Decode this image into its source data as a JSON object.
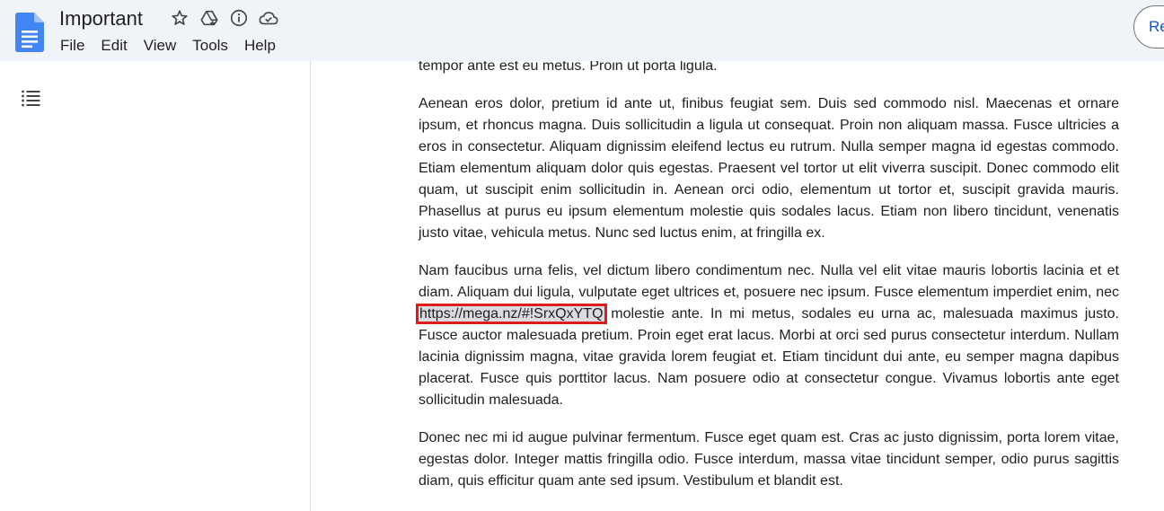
{
  "doc": {
    "title": "Important"
  },
  "menu": [
    "File",
    "Edit",
    "View",
    "Tools",
    "Help"
  ],
  "share_label": "Re",
  "icons": {
    "logo": "google-docs-icon",
    "star": "star-icon",
    "move": "move-to-drive-icon",
    "info": "info-icon",
    "cloud": "cloud-saved-icon",
    "outline": "document-outline-icon"
  },
  "colors": {
    "topbar": "#f0f4f9",
    "docs_blue": "#4285f4",
    "highlight_border": "#e01b1b",
    "link_background": "#dadce0"
  },
  "paragraphs": [
    {
      "before": "tempor ante est eu metus. Proin ut porta ligula.",
      "link": "",
      "after": ""
    },
    {
      "before": "Aenean eros dolor, pretium id ante ut, finibus feugiat sem. Duis sed commodo nisl. Maecenas et ornare ipsum, et rhoncus magna. Duis sollicitudin a ligula ut consequat. Proin non aliquam massa. Fusce ultricies a eros in consectetur. Aliquam dignissim eleifend lectus eu rutrum. Nulla semper magna id egestas commodo. Etiam elementum aliquam dolor quis egestas. Praesent vel tortor ut elit viverra suscipit. Donec commodo elit quam, ut suscipit enim sollicitudin in. Aenean orci odio, elementum ut tortor et, suscipit gravida mauris. Phasellus at purus eu ipsum elementum molestie quis sodales lacus. Etiam non libero tincidunt, venenatis justo vitae, vehicula metus. Nunc sed luctus enim, at fringilla ex.",
      "link": "",
      "after": ""
    },
    {
      "before": "Nam faucibus urna felis, vel dictum libero condimentum nec. Nulla vel elit vitae mauris lobortis lacinia et et diam. Aliquam dui ligula, vulputate eget ultrices et, posuere nec ipsum. Fusce elementum imperdiet enim, nec ",
      "link": "https://mega.nz/#!SrxQxYTQ",
      "after": " molestie ante. In mi metus, sodales eu urna ac, malesuada maximus justo. Fusce auctor malesuada pretium. Proin eget erat lacus. Morbi at orci sed purus consectetur interdum. Nullam lacinia dignissim magna, vitae gravida lorem feugiat et. Etiam tincidunt dui ante, eu semper magna dapibus placerat. Fusce quis porttitor lacus. Nam posuere odio at consectetur congue. Vivamus lobortis ante eget sollicitudin malesuada."
    },
    {
      "before": "Donec nec mi id augue pulvinar fermentum. Fusce eget quam est. Cras ac justo dignissim, porta lorem vitae, egestas dolor. Integer mattis fringilla odio. Fusce interdum, massa vitae tincidunt semper, odio purus sagittis diam, quis efficitur quam ante sed ipsum. Vestibulum et blandit est.",
      "link": "",
      "after": ""
    }
  ]
}
